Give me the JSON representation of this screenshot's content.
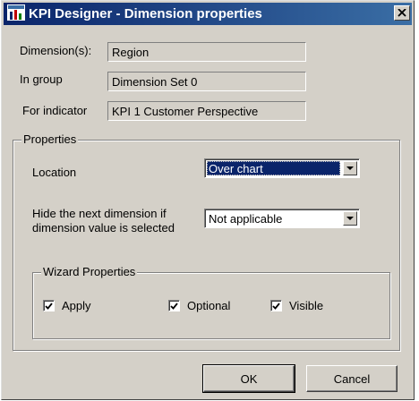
{
  "window": {
    "title": "KPI Designer - Dimension properties",
    "icon": "kpi-designer-app-icon",
    "close_icon": "close-icon"
  },
  "fields": {
    "dimension_label": "Dimension(s):",
    "dimension_value": "Region",
    "group_label": "In group",
    "group_value": "Dimension Set 0",
    "indicator_label": "For indicator",
    "indicator_value": "KPI 1 Customer Perspective"
  },
  "properties": {
    "title": "Properties",
    "location_label": "Location",
    "location_value": "Over chart",
    "hide_label_line1": "Hide the next dimension if",
    "hide_label_line2": "dimension value is selected",
    "hide_value": "Not applicable"
  },
  "wizard": {
    "title": "Wizard Properties",
    "checkboxes": [
      {
        "label": "Apply",
        "checked": true
      },
      {
        "label": "Optional",
        "checked": true
      },
      {
        "label": "Visible",
        "checked": true
      }
    ]
  },
  "buttons": {
    "ok": "OK",
    "cancel": "Cancel"
  },
  "colors": {
    "titlebar_start": "#0a246a",
    "titlebar_end": "#3a6ea5",
    "dialog_face": "#d4d0c8",
    "selection": "#0a246a"
  }
}
